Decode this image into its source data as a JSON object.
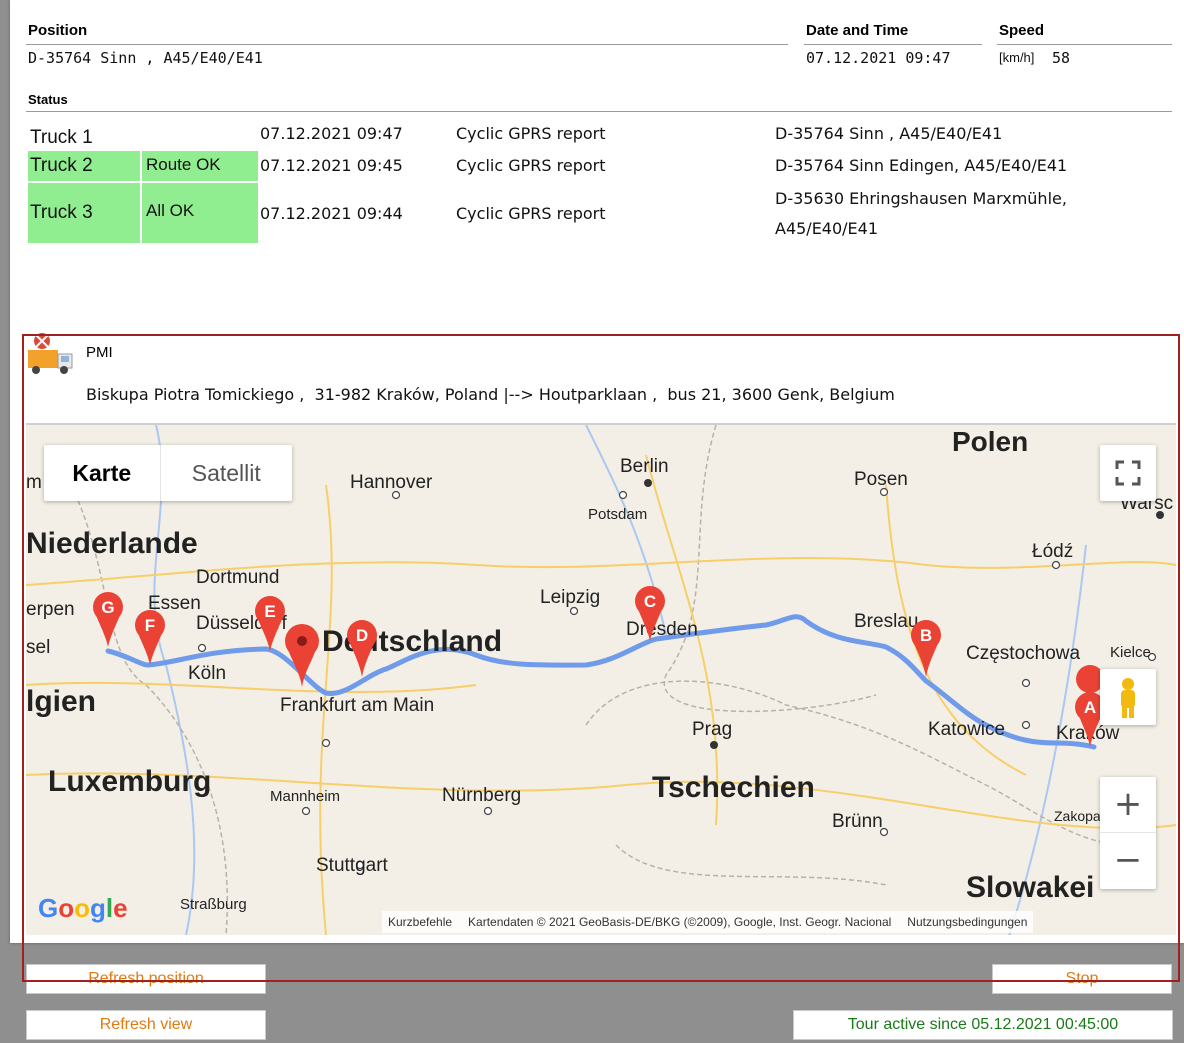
{
  "header": {
    "position_label": "Position",
    "position_value": "D-35764 Sinn , A45/E40/E41",
    "datetime_label": "Date and Time",
    "datetime_value": "07.12.2021 09:47",
    "speed_label": "Speed",
    "speed_unit": "[km/h]",
    "speed_value": "58"
  },
  "status": {
    "label": "Status",
    "rows": [
      {
        "truck": "Truck 1",
        "state": "",
        "time": "07.12.2021 09:47",
        "report": "Cyclic GPRS report",
        "location": "D-35764 Sinn , A45/E40/E41",
        "location2": ""
      },
      {
        "truck": "Truck 2",
        "state": "Route OK",
        "time": "07.12.2021 09:45",
        "report": "Cyclic GPRS report",
        "location": "D-35764 Sinn Edingen, A45/E40/E41",
        "location2": ""
      },
      {
        "truck": "Truck 3",
        "state": "All OK",
        "time": "07.12.2021 09:44",
        "report": "Cyclic GPRS report",
        "location": "D-35630 Ehringshausen Marxmühle,",
        "location2": "A45/E40/E41"
      }
    ]
  },
  "tour": {
    "company": "PMI",
    "route_text": "Biskupa Piotra Tomickiego ,  31-982 Kraków, Poland |--> Houtparklaan ,  bus 21, 3600 Genk, Belgium"
  },
  "map": {
    "type_map": "Karte",
    "type_satellite": "Satellit",
    "countries": [
      "Polen",
      "Niederlande",
      "Deutschland",
      "lgien",
      "Luxemburg",
      "Tschechien",
      "Slowakei"
    ],
    "cities": [
      "Berlin",
      "Hannover",
      "Potsdam",
      "Posen",
      "Łódź",
      "Dortmund",
      "Essen",
      "Düsseldorf",
      "Köln",
      "Leipzig",
      "Dresden",
      "Breslau",
      "Częstochowa",
      "Kielce",
      "Frankfurt am Main",
      "Katowice",
      "Kraków",
      "Prag",
      "Mannheim",
      "Nürnberg",
      "Brünn",
      "Stuttgart",
      "Straßburg",
      "Zakopane",
      "Warsc",
      "sel",
      "erpen",
      "m"
    ],
    "markers": [
      "A",
      "B",
      "C",
      "D",
      "E",
      "F",
      "G"
    ],
    "google": "Google",
    "footer_shortcuts": "Kurzbefehle",
    "footer_data": "Kartendaten © 2021 GeoBasis-DE/BKG (©2009), Google, Inst. Geogr. Nacional",
    "footer_terms": "Nutzungsbedingungen",
    "zoom_in": "+",
    "zoom_out": "−"
  },
  "buttons": {
    "refresh_position": "Refresh position",
    "stop": "Stop",
    "refresh_view": "Refresh view",
    "tour_active": "Tour active since 05.12.2021 00:45:00"
  },
  "colors": {
    "status_ok": "#90ee90",
    "route_line": "#6f9bea",
    "marker_red": "#ea4335",
    "highlight_frame": "#a32020",
    "button_text_orange": "#e07b12",
    "tour_text_green": "#1a7a1a"
  }
}
